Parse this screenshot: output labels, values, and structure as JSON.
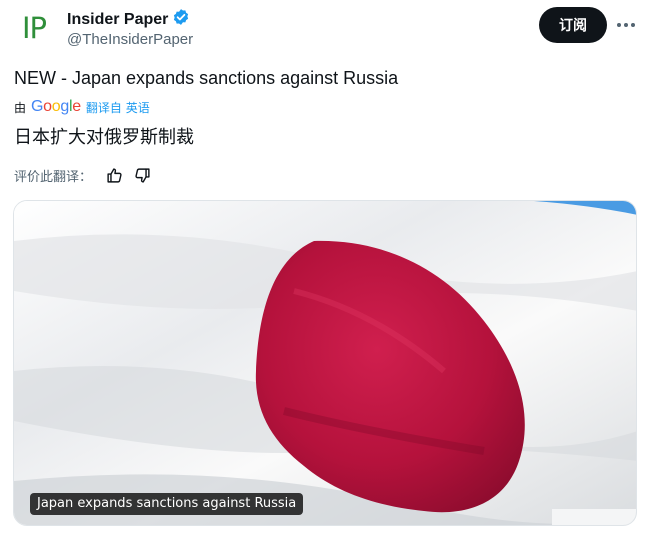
{
  "account": {
    "avatar_text": "IP",
    "display_name": "Insider Paper",
    "handle": "@TheInsiderPaper",
    "verified_icon": "verified-badge-icon",
    "verified_color": "#1d9bf0"
  },
  "actions": {
    "subscribe_label": "订阅",
    "more_icon": "more-dots-icon"
  },
  "tweet": {
    "text": "NEW - Japan expands sanctions against Russia",
    "translation": {
      "by_label": "由",
      "provider_letters": [
        "G",
        "o",
        "o",
        "g",
        "l",
        "e"
      ],
      "translated_from": "翻译自 英语",
      "translated_text": "日本扩大对俄罗斯制裁"
    },
    "rate": {
      "label": "评价此翻译：",
      "thumbs_up_icon": "thumbs-up-icon",
      "thumbs_down_icon": "thumbs-down-icon"
    }
  },
  "media": {
    "caption": "Japan expands sanctions against Russia",
    "flag_white": "#f2f3f5",
    "flag_red": "#c21844"
  }
}
